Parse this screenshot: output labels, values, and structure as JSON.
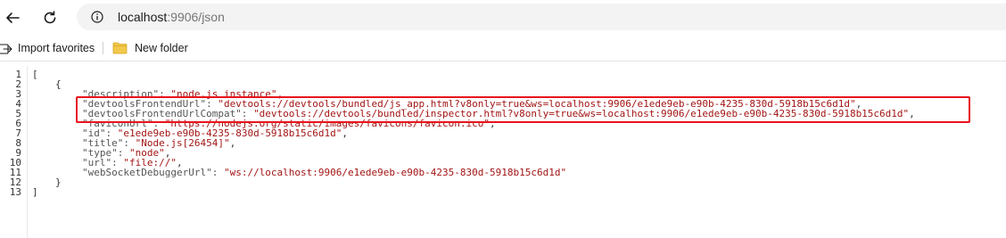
{
  "address_bar": {
    "host": "localhost",
    "path": ":9906/json"
  },
  "favorites_bar": {
    "import_label": "Import favorites",
    "folder_label": "New folder"
  },
  "json_view": {
    "line_numbers": [
      "1",
      "2",
      "3",
      "4",
      "5",
      "6",
      "7",
      "8",
      "9",
      "10",
      "11",
      "12",
      "13"
    ],
    "lines": [
      {
        "key": "",
        "value": "[",
        "tail": ""
      },
      {
        "key": "",
        "value": "{",
        "tail": ""
      },
      {
        "key": "\"description\": ",
        "value": "\"node.js instance\"",
        "tail": ","
      },
      {
        "key": "\"devtoolsFrontendUrl\": ",
        "value": "\"devtools://devtools/bundled/js_app.html?v8only=true&ws=localhost:9906/e1ede9eb-e90b-4235-830d-5918b15c6d1d\"",
        "tail": ","
      },
      {
        "key": "\"devtoolsFrontendUrlCompat\": ",
        "value": "\"devtools://devtools/bundled/inspector.html?v8only=true&ws=localhost:9906/e1ede9eb-e90b-4235-830d-5918b15c6d1d\"",
        "tail": ","
      },
      {
        "key": "\"faviconUrl\": ",
        "value": "\"https://nodejs.org/static/images/favicons/favicon.ico\"",
        "tail": ","
      },
      {
        "key": "\"id\": ",
        "value": "\"e1ede9eb-e90b-4235-830d-5918b15c6d1d\"",
        "tail": ","
      },
      {
        "key": "\"title\": ",
        "value": "\"Node.js[26454]\"",
        "tail": ","
      },
      {
        "key": "\"type\": ",
        "value": "\"node\"",
        "tail": ","
      },
      {
        "key": "\"url\": ",
        "value": "\"file://\"",
        "tail": ","
      },
      {
        "key": "\"webSocketDebuggerUrl\": ",
        "value": "\"ws://localhost:9906/e1ede9eb-e90b-4235-830d-5918b15c6d1d\"",
        "tail": ""
      },
      {
        "key": "",
        "value": "}",
        "tail": ""
      },
      {
        "key": "",
        "value": "]",
        "tail": ""
      }
    ]
  },
  "colors": {
    "highlight_border": "#e8141c",
    "string_value": "#a31515"
  }
}
